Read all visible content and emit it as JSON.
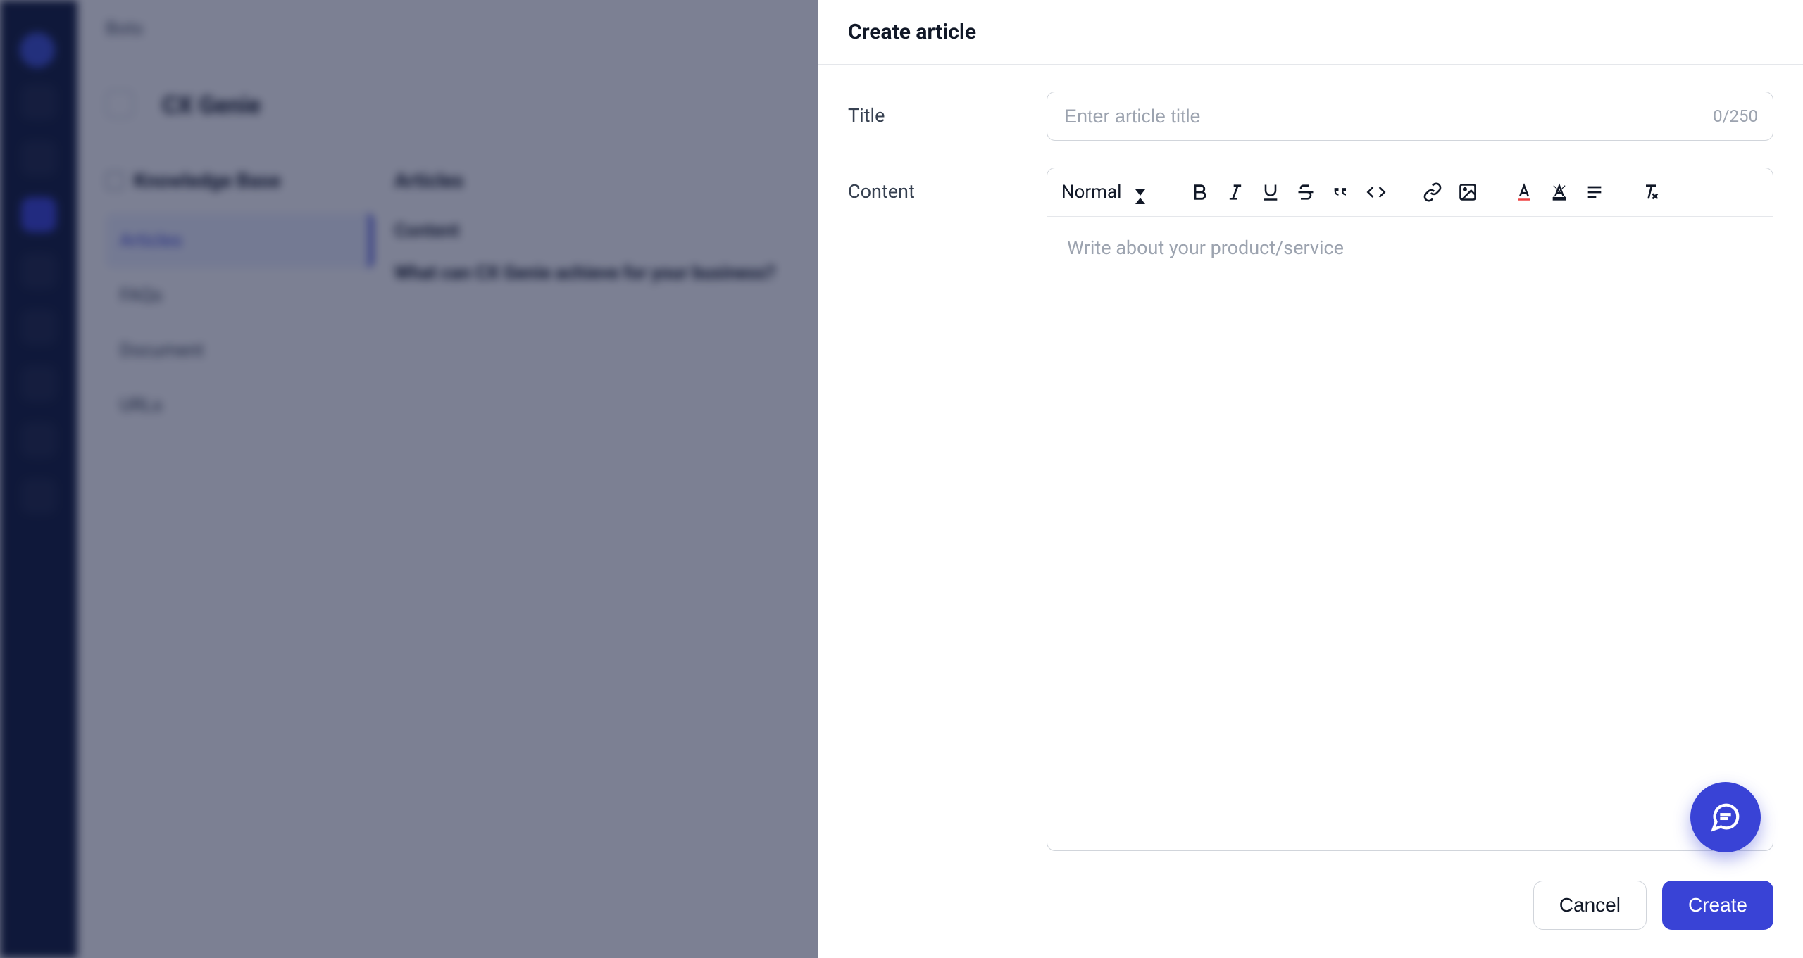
{
  "background": {
    "breadcrumb": "Bots",
    "page_title": "CX Genie",
    "kb_heading": "Knowledge Base",
    "kb_items": [
      "Articles",
      "FAQs",
      "Document",
      "URLs"
    ],
    "articles_heading": "Articles",
    "column_content": "Content",
    "row_text": "What can CX Genie achieve for your business?"
  },
  "drawer": {
    "header_title": "Create article",
    "title_label": "Title",
    "title_placeholder": "Enter article title",
    "title_counter": "0/250",
    "content_label": "Content",
    "format_label": "Normal",
    "content_placeholder": "Write about your product/service",
    "cancel_label": "Cancel",
    "create_label": "Create"
  },
  "toolbar_icons": {
    "bold": "bold-icon",
    "italic": "italic-icon",
    "underline": "underline-icon",
    "strike": "strikethrough-icon",
    "quote": "blockquote-icon",
    "code": "code-icon",
    "link": "link-icon",
    "image": "image-icon",
    "textcolor": "text-color-icon",
    "highlight": "highlight-icon",
    "list": "list-icon",
    "clear": "clear-format-icon"
  }
}
